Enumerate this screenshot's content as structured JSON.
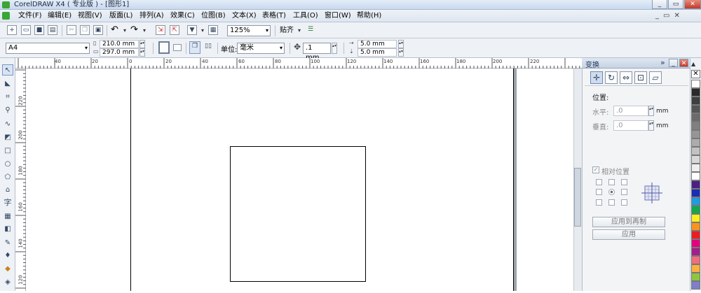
{
  "window": {
    "title": "CorelDRAW X4 ( 专业版 ) - [图形1]",
    "min_icon": "_",
    "max_icon": "▭",
    "close_icon": "✕"
  },
  "menu": [
    "文件(F)",
    "编辑(E)",
    "视图(V)",
    "版面(L)",
    "排列(A)",
    "效果(C)",
    "位图(B)",
    "文本(X)",
    "表格(T)",
    "工具(O)",
    "窗口(W)",
    "帮助(H)"
  ],
  "standard_toolbar": {
    "zoom": "125%",
    "snap_label": "贴齐"
  },
  "property_bar": {
    "paper_size": "A4",
    "width": "210.0 mm",
    "height": "297.0 mm",
    "units_label": "单位:",
    "units_value": "毫米",
    "nudge": ".1 mm",
    "dup_x": "5.0 mm",
    "dup_y": "5.0 mm"
  },
  "ruler": {
    "h_labels": [
      "40",
      "20",
      "0",
      "20",
      "40",
      "60",
      "80",
      "100",
      "120",
      "140",
      "160",
      "180",
      "200",
      "220"
    ],
    "v_labels": [
      "220",
      "200",
      "180",
      "160",
      "140",
      "120"
    ]
  },
  "toolbox": {
    "text_tool": "字"
  },
  "docker": {
    "title": "变换",
    "collapse_icon": "»",
    "position_label": "位置:",
    "horizontal_label": "水平:",
    "horizontal_value": ".0",
    "vertical_label": "垂直:",
    "vertical_value": ".0",
    "unit": "mm",
    "relative_label": "相对位置",
    "relative_checked": true,
    "apply_copy_label": "应用到再制",
    "apply_label": "应用"
  },
  "palette": {
    "colors": [
      "#ffffff",
      "#2a2a2a",
      "#3f3f3f",
      "#555555",
      "#6b6b6b",
      "#808080",
      "#969696",
      "#acacac",
      "#c2c2c2",
      "#d8d8d8",
      "#eeeeee",
      "#ffffff",
      "#4b1f84",
      "#1c2db3",
      "#1f9be0",
      "#13a84a",
      "#fcee21",
      "#f7941d",
      "#ed1c24",
      "#e5007e",
      "#a21f87",
      "#f26d7d",
      "#fbb040",
      "#8dc63f",
      "#7f7fc9"
    ]
  },
  "annotation": {
    "arrow_color": "#d62b2b"
  }
}
